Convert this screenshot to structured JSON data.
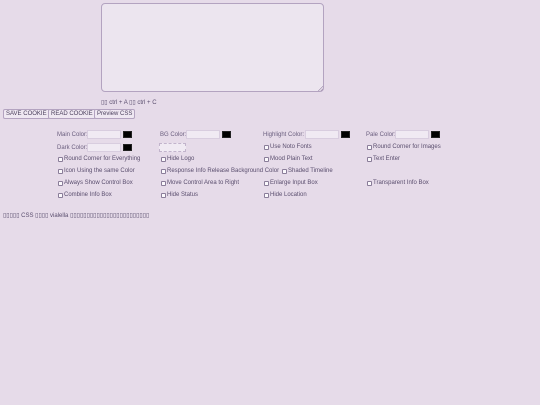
{
  "editor": {
    "value": ""
  },
  "hint": {
    "text": "▯▯ ctrl + A ▯▯ ctrl + C"
  },
  "buttons": {
    "save": "SAVE COOKIE",
    "read": "READ COOKIE",
    "preview": "Preview CSS"
  },
  "colors": {
    "main": {
      "label": "Main Color:",
      "value": "#000000"
    },
    "dark": {
      "label": "Dark Color:",
      "value": "#000000"
    },
    "bg": {
      "label": "BG Color:",
      "value": "#000000"
    },
    "highlight": {
      "label": "Highlight Color:",
      "value": "#000000"
    },
    "pale": {
      "label": "Pale Color:",
      "value": "#000000"
    }
  },
  "options": {
    "round_corner_everything": "Round Corner for Everything",
    "icon_same_color": "Icon Using the same Color",
    "always_show_control_box": "Always Show Control Box",
    "combine_info_box": "Combine Info Box",
    "hide_logo": "Hide Logo",
    "response_info_release_bg": "Response Info Release Background Color",
    "move_control_area_right": "Move Control Area to Right",
    "hide_status": "Hide Status",
    "use_noto_fonts": "Use Noto Fonts",
    "mood_plain_text": "Mood Plain Text",
    "shaded_timeline": "Shaded Timeline",
    "enlarge_input_box": "Enlarge Input Box",
    "hide_location": "Hide Location",
    "round_corner_images": "Round Corner for Images",
    "text_enter": "Text Enter",
    "transparent_info_box": "Transparent Info Box"
  },
  "footer": {
    "text": "▯▯▯▯▯ CSS ▯▯▯▯ vialella ▯▯▯▯▯▯▯▯▯▯▯▯▯▯▯▯▯▯▯▯▯▯▯▯"
  }
}
